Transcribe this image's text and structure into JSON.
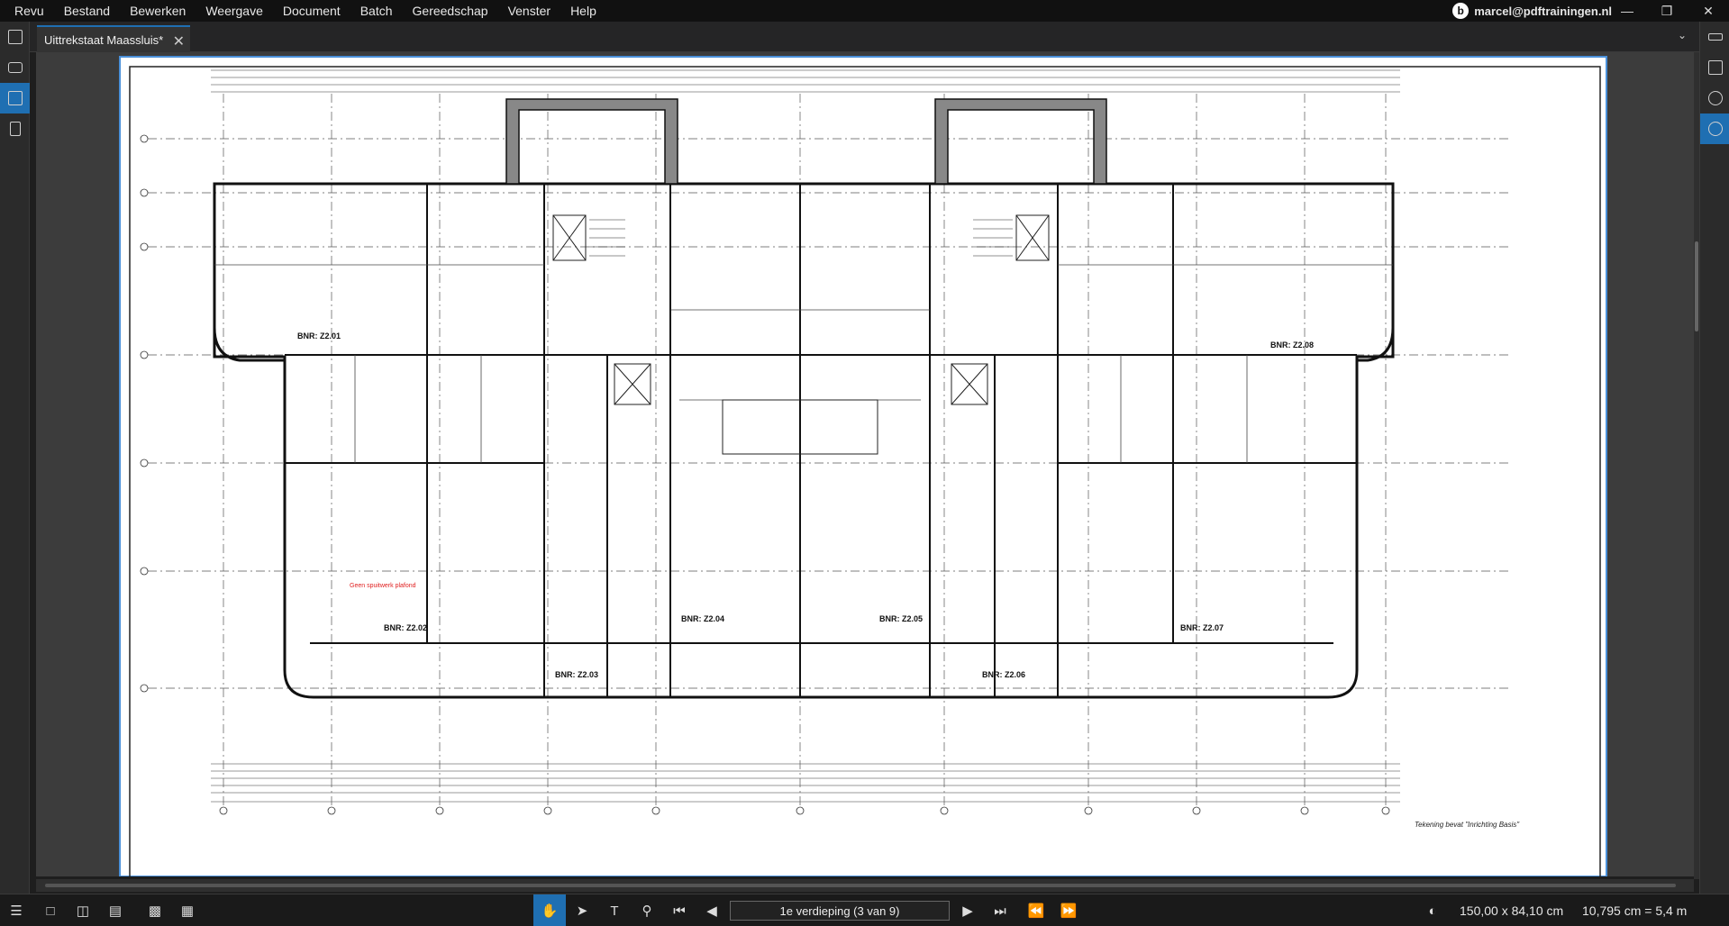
{
  "app": {
    "menu": [
      "Revu",
      "Bestand",
      "Bewerken",
      "Weergave",
      "Document",
      "Batch",
      "Gereedschap",
      "Venster",
      "Help"
    ],
    "account": "marcel@pdftrainingen.nl"
  },
  "tabs": [
    {
      "label": "Uittrekstaat Maassluis*"
    }
  ],
  "drawing": {
    "units": [
      {
        "label": "BNR: Z2.01"
      },
      {
        "label": "BNR: Z2.02"
      },
      {
        "label": "BNR: Z2.03"
      },
      {
        "label": "BNR: Z2.04"
      },
      {
        "label": "BNR: Z2.05"
      },
      {
        "label": "BNR: Z2.06"
      },
      {
        "label": "BNR: Z2.07"
      },
      {
        "label": "BNR: Z2.08"
      }
    ],
    "red_note": "Geen spuitwerk plafond",
    "footer_note": "Tekening bevat \"Inrichting Basis\""
  },
  "statusbar": {
    "page_label": "1e verdieping (3 van 9)",
    "page_size": "150,00 x 84,10 cm",
    "scale": "10,795 cm = 5,4 m"
  },
  "colors": {
    "accent": "#1f6fb2",
    "red_note": "#e02020"
  }
}
